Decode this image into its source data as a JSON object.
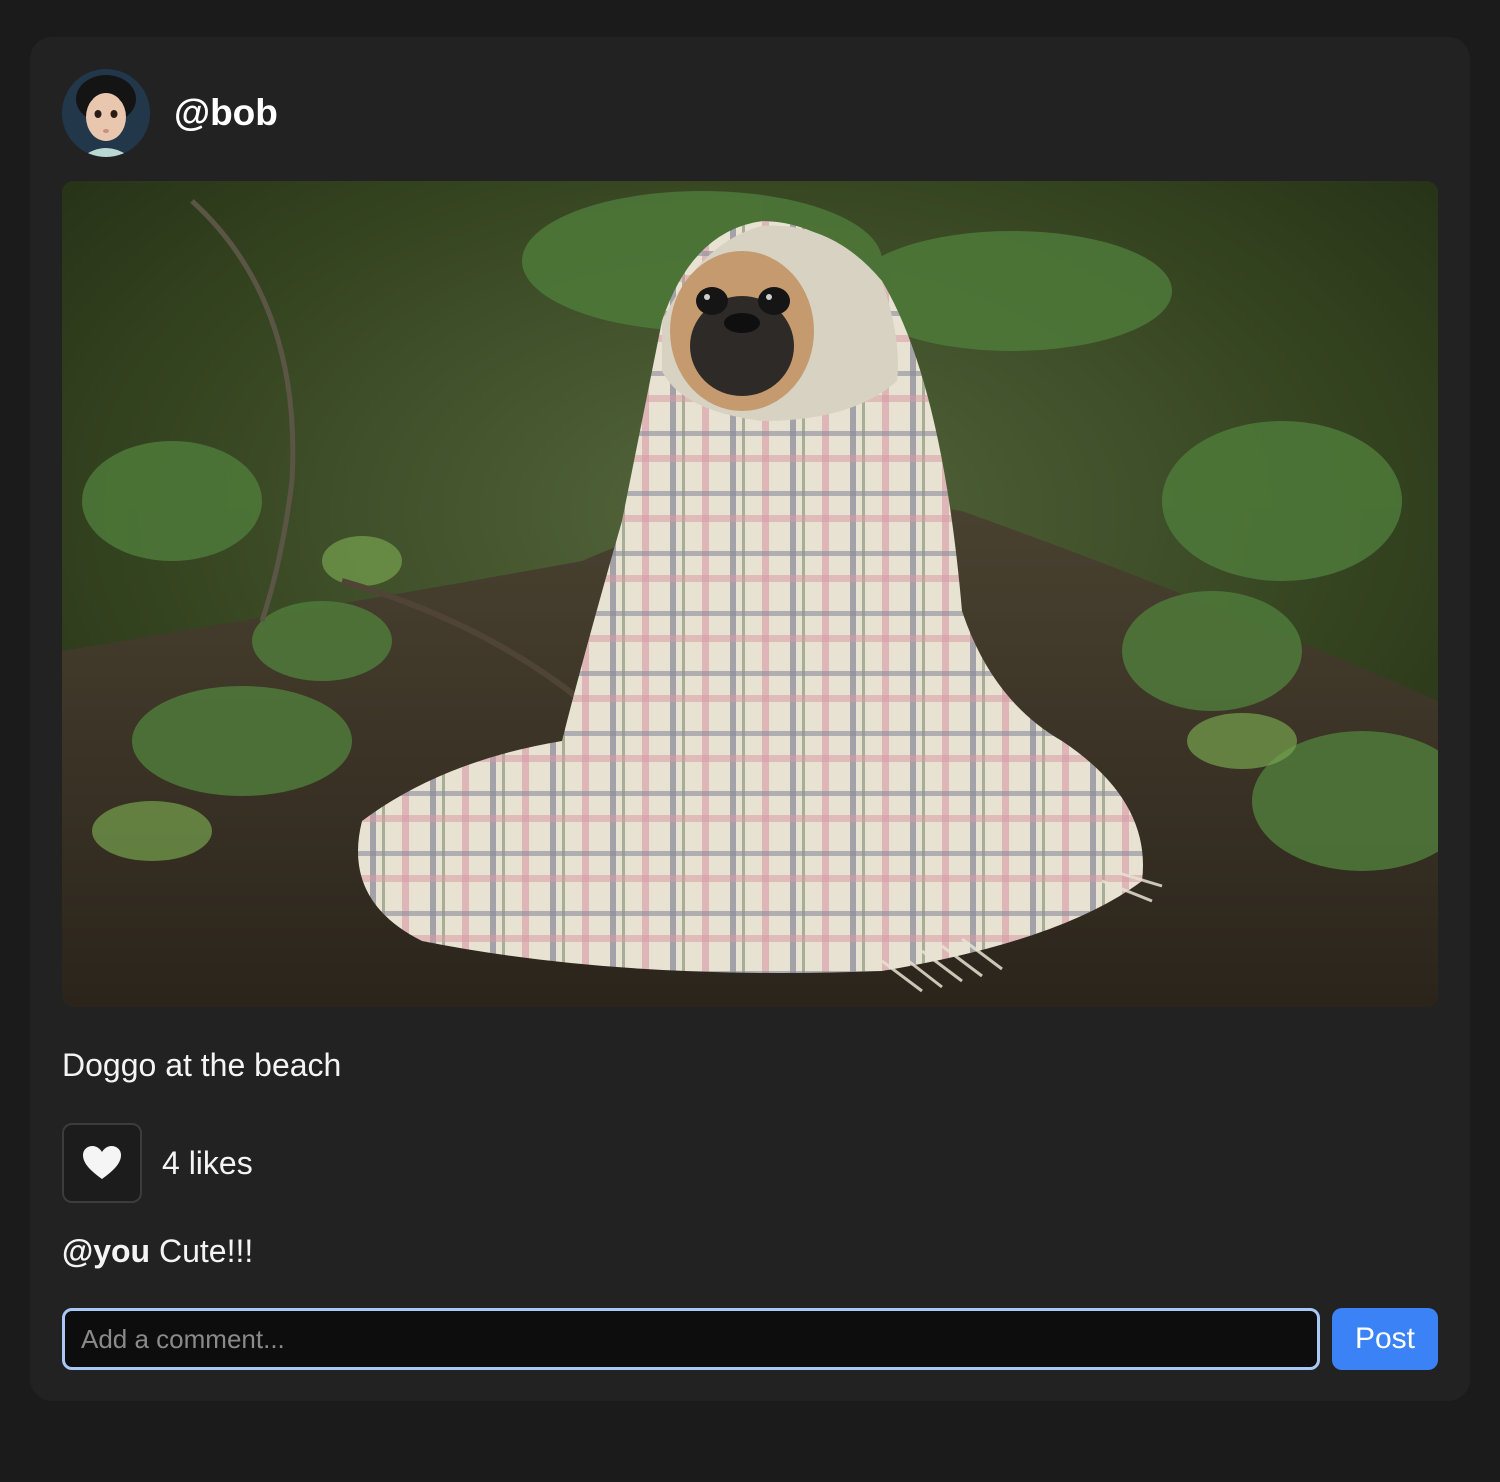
{
  "post": {
    "username": "@bob",
    "avatar_icon": "avatar-child-photo",
    "image_description_icon": "pug-in-blanket-photo",
    "caption": "Doggo at the beach",
    "likes_text": "4 likes",
    "like_icon": "heart-icon",
    "comments": [
      {
        "author": "@you",
        "text": " Cute!!!"
      }
    ]
  },
  "comment_form": {
    "placeholder": "Add a comment...",
    "value": "",
    "post_label": "Post"
  },
  "colors": {
    "background": "#1b1b1c",
    "card": "#222222",
    "accent": "#3b82f6",
    "input_focus_ring": "#a9c8f4"
  }
}
